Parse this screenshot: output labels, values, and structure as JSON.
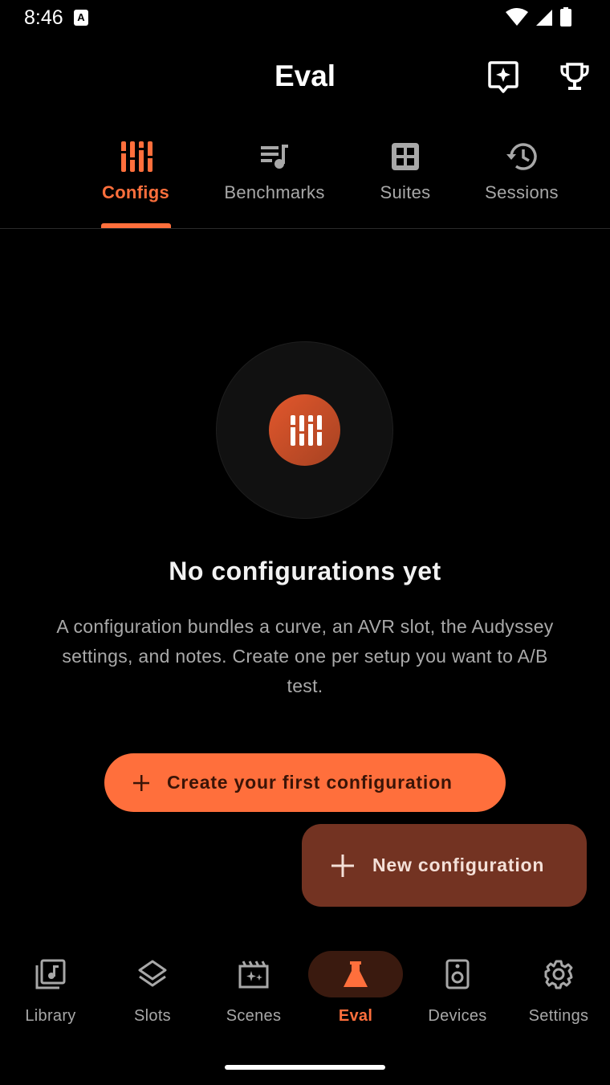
{
  "status_bar": {
    "time": "8:46",
    "notification_glyph": "A"
  },
  "app_bar": {
    "title": "Eval",
    "actions": [
      "sparkle-icon",
      "trophy-icon"
    ]
  },
  "tabs": [
    {
      "label": "Configs",
      "icon": "sliders-icon",
      "active": true
    },
    {
      "label": "Benchmarks",
      "icon": "queue-music-icon",
      "active": false
    },
    {
      "label": "Suites",
      "icon": "grid-icon",
      "active": false
    },
    {
      "label": "Sessions",
      "icon": "history-icon",
      "active": false
    }
  ],
  "empty_state": {
    "icon": "sliders-icon",
    "title": "No configurations yet",
    "description": "A configuration bundles a curve, an AVR slot, the Audyssey settings, and notes. Create one per setup you want to A/B test.",
    "primary_button": "Create your first configuration"
  },
  "fab": {
    "label": "New configuration"
  },
  "bottom_nav": [
    {
      "label": "Library",
      "icon": "library-music-icon",
      "active": false
    },
    {
      "label": "Slots",
      "icon": "layers-icon",
      "active": false
    },
    {
      "label": "Scenes",
      "icon": "movie-filter-icon",
      "active": false
    },
    {
      "label": "Eval",
      "icon": "flask-icon",
      "active": true
    },
    {
      "label": "Devices",
      "icon": "speaker-icon",
      "active": false
    },
    {
      "label": "Settings",
      "icon": "gear-icon",
      "active": false
    }
  ],
  "colors": {
    "accent": "#ff6f3c",
    "fab_bg": "#733322",
    "background": "#000000",
    "muted_text": "#a8a8a8"
  }
}
